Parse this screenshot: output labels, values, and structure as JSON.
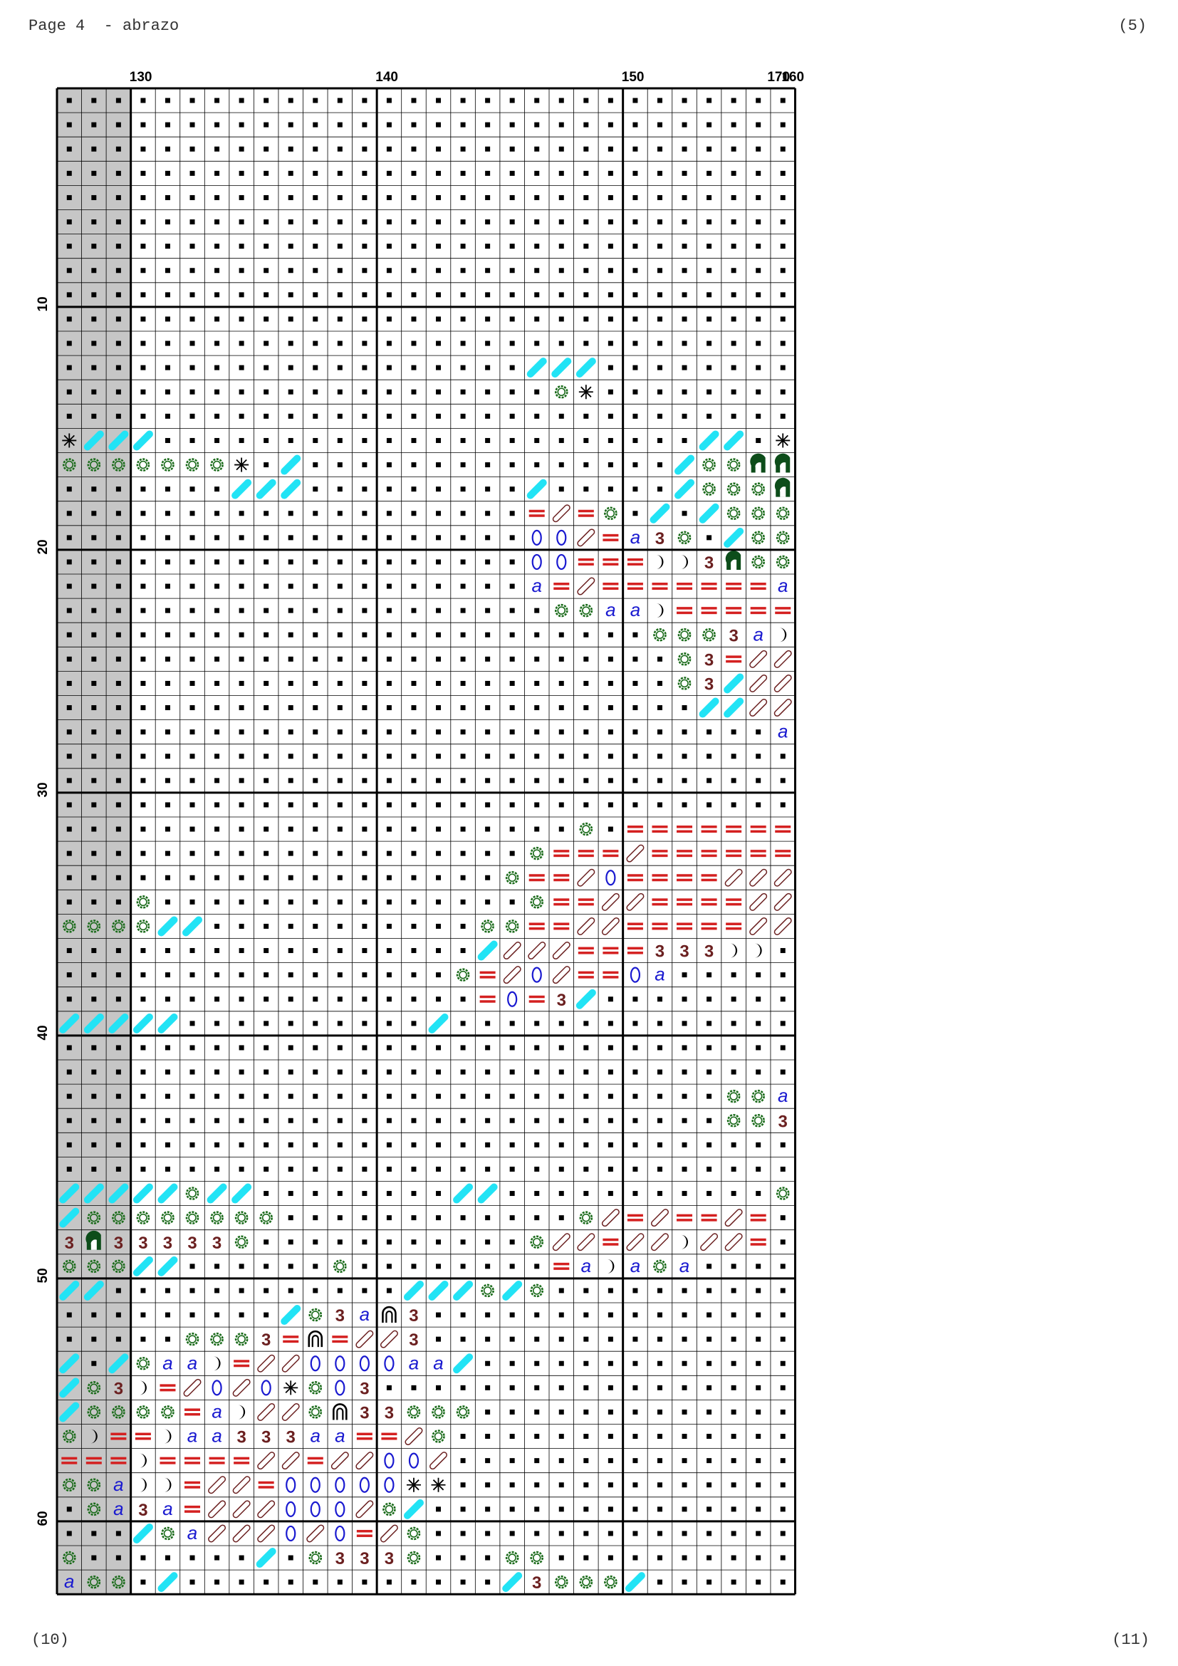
{
  "header": {
    "title": "Page 4  - abrazo",
    "page_number": "(5)"
  },
  "footer": {
    "left_page": "(10)",
    "right_page": "(11)"
  },
  "grid": {
    "column_labels": [
      "130",
      "140",
      "150",
      "160",
      "170"
    ],
    "row_labels": [
      "10",
      "20",
      "30",
      "40",
      "50",
      "60"
    ]
  },
  "colors": {
    "cyan_stitch": "#22e3f5",
    "green_sun": "#1a6b1a",
    "red_equals": "#d42020",
    "blue_letter": "#1a1ad0",
    "brown_three": "#6b2020",
    "dark_green_arc": "#0d4d1a",
    "shaded_columns": "#c6c6c6",
    "grid_line": "#000000"
  },
  "symbols": {
    "dot": "filled-square-dot",
    "cyan": "cyan-diagonal-stroke",
    "sun": "green-gear-sun",
    "equals": "red-double-bar",
    "a": "blue-letter-a",
    "o": "blue-oval",
    "slash": "outlined-diagonal-bead",
    "moon": "black-crescent",
    "three": "brown-three",
    "arch": "black-arch",
    "arc": "green-quarter-arc",
    "star": "black-asterisk"
  }
}
